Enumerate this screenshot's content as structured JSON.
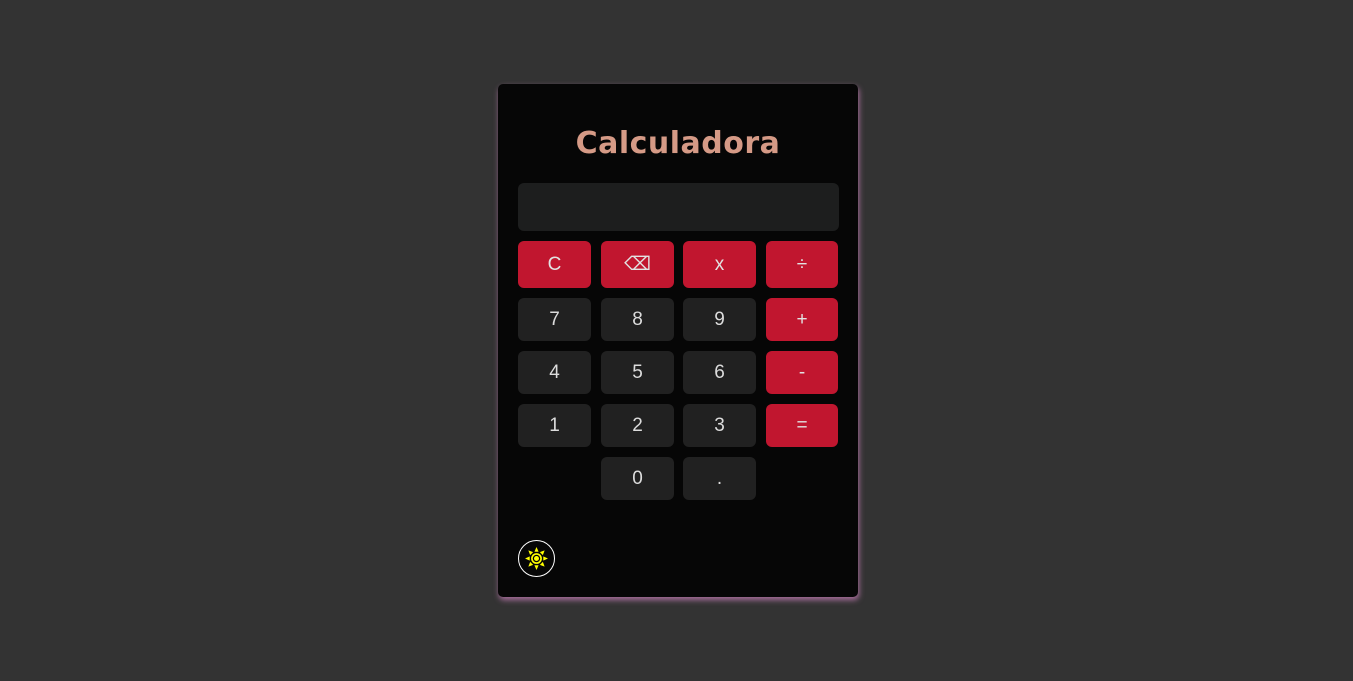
{
  "calculator": {
    "title": "Calculadora",
    "display_value": ""
  },
  "buttons": {
    "clear": "C",
    "backspace": "⌫",
    "multiply": "x",
    "divide": "÷",
    "seven": "7",
    "eight": "8",
    "nine": "9",
    "add": "+",
    "four": "4",
    "five": "5",
    "six": "6",
    "subtract": "-",
    "one": "1",
    "two": "2",
    "three": "3",
    "equals": "=",
    "zero": "0",
    "decimal": "."
  },
  "theme_toggle": {
    "icon": "sun-icon",
    "color": "#ffff00"
  },
  "colors": {
    "background": "#333333",
    "panel": "#060606",
    "accent": "#c1162f",
    "number_key": "#212121",
    "title": "#d59a86",
    "glow": "#cd82be"
  }
}
